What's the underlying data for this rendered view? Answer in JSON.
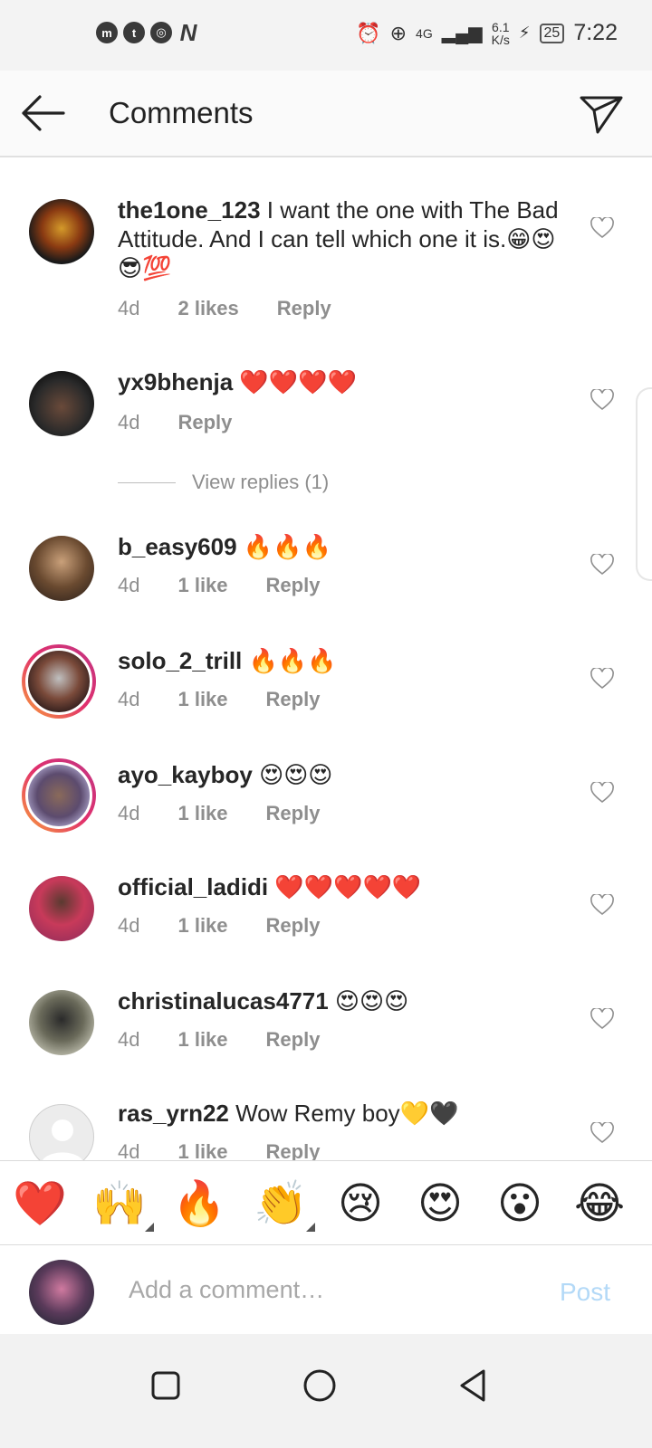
{
  "status_bar": {
    "left_icons": [
      "messenger-icon",
      "twitter-icon",
      "chrome-icon",
      "n-icon"
    ],
    "network_type": "4G",
    "speed_value": "6.1",
    "speed_unit": "K/s",
    "battery": "25",
    "time": "7:22"
  },
  "header": {
    "title": "Comments"
  },
  "comments": [
    {
      "username": "the1one_123",
      "text": " I want the one with The Bad Attitude.  And I can tell which one it is.😁😍😎💯",
      "age": "4d",
      "likes": "2 likes",
      "reply": "Reply",
      "avatar_color": "#3b2a12"
    },
    {
      "username": "yx9bhenja",
      "text": " ❤️❤️❤️❤️",
      "age": "4d",
      "likes": "",
      "reply": "Reply",
      "avatar_color": "#2a2a2a"
    },
    {
      "username": "b_easy609",
      "text": " 🔥🔥🔥",
      "age": "4d",
      "likes": "1 like",
      "reply": "Reply",
      "avatar_color": "#b08a60"
    },
    {
      "username": "solo_2_trill",
      "text": " 🔥🔥🔥",
      "age": "4d",
      "likes": "1 like",
      "reply": "Reply",
      "avatar_color": "#7a4a3a"
    },
    {
      "username": "ayo_kayboy",
      "text": " 😍😍😍",
      "age": "4d",
      "likes": "1 like",
      "reply": "Reply",
      "avatar_color": "#5c4b6e"
    },
    {
      "username": "official_ladidi",
      "text": " ❤️❤️❤️❤️❤️",
      "age": "4d",
      "likes": "1 like",
      "reply": "Reply",
      "avatar_color": "#a0305a"
    },
    {
      "username": "christinalucas4771",
      "text": " 😍😍😍",
      "age": "4d",
      "likes": "1 like",
      "reply": "Reply",
      "avatar_color": "#8a8a7a"
    },
    {
      "username": "ras_yrn22",
      "text": " Wow Remy boy💛🖤",
      "age": "4d",
      "likes": "1 like",
      "reply": "Reply",
      "avatar_color": "#d9d9d9"
    }
  ],
  "view_replies": "View replies (1)",
  "emoji_bar": [
    "❤️",
    "🙌",
    "🔥",
    "👏",
    "😢",
    "😍",
    "😮",
    "😂"
  ],
  "comment_input": {
    "placeholder": "Add a comment…"
  },
  "post_label": "Post",
  "colors": {
    "accent_disabled": "#b3d9f7",
    "meta_grey": "#8e8e8e"
  }
}
